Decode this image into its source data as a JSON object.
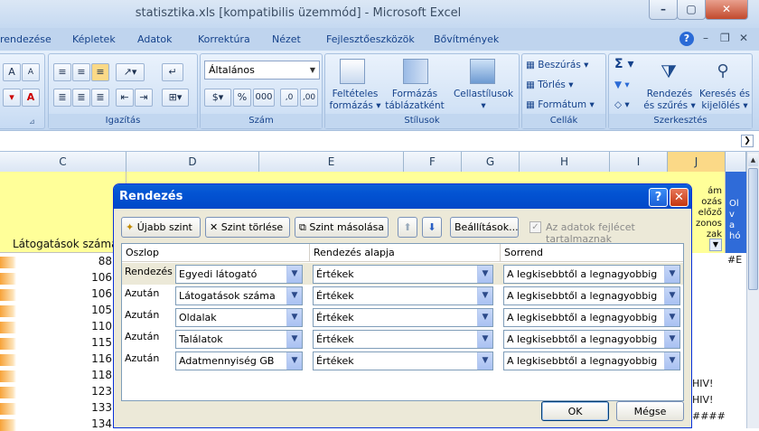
{
  "window": {
    "title": "statisztika.xls  [kompatibilis üzemmód] - Microsoft Excel"
  },
  "tabs": [
    "rendezése",
    "Képletek",
    "Adatok",
    "Korrektúra",
    "Nézet",
    "Fejlesztőeszközök",
    "Bővítmények"
  ],
  "ribbon": {
    "font_size_grow": "A",
    "font_size_shrink": "A",
    "number_format": "Általános",
    "groups": {
      "alignment": "Igazítás",
      "number": "Szám",
      "styles": "Stílusok",
      "cells": "Cellák",
      "editing": "Szerkesztés"
    },
    "styles": {
      "conditional": "Feltételes formázás",
      "format_table": "Formázás táblázatként",
      "cell_styles": "Cellastílusok"
    },
    "cells": {
      "insert": "Beszúrás",
      "delete": "Törlés",
      "format": "Formátum"
    },
    "editing": {
      "sort_filter": "Rendezés és szűrés",
      "find_select": "Keresés és kijelölés"
    },
    "number_buttons": {
      "percent": "%",
      "thousands": "000"
    }
  },
  "columns": [
    "C",
    "D",
    "E",
    "F",
    "G",
    "H",
    "I",
    "J"
  ],
  "sheet": {
    "header_c": "Látogatások száma",
    "values": [
      "88",
      "106",
      "106",
      "105",
      "110",
      "115",
      "116",
      "118",
      "123",
      "133",
      "134"
    ],
    "col_j_fragments": [
      "ám",
      "ozás",
      "előző",
      "zonos",
      "zak",
      "#E",
      "HIV!",
      "HIV!",
      "####"
    ],
    "col_k_fragments": [
      "Ol",
      "v",
      "a",
      "hó"
    ]
  },
  "dialog": {
    "title": "Rendezés",
    "help": "?",
    "close": "✕",
    "add_level": "Újabb szint",
    "delete_level": "Szint törlése",
    "copy_level": "Szint másolása",
    "options": "Beállítások...",
    "header_checkbox": "Az adatok fejlécet tartalmaznak",
    "col_headers": {
      "column": "Oszlop",
      "sort_on": "Rendezés alapja",
      "order": "Sorrend"
    },
    "rows": [
      {
        "label": "Rendezés",
        "column": "Egyedi látogató",
        "sort_on": "Értékek",
        "order": "A legkisebbtől a legnagyobbig"
      },
      {
        "label": "Azután",
        "column": "Látogatások száma",
        "sort_on": "Értékek",
        "order": "A legkisebbtől a legnagyobbig"
      },
      {
        "label": "Azután",
        "column": "Oldalak",
        "sort_on": "Értékek",
        "order": "A legkisebbtől a legnagyobbig"
      },
      {
        "label": "Azután",
        "column": "Találatok",
        "sort_on": "Értékek",
        "order": "A legkisebbtől a legnagyobbig"
      },
      {
        "label": "Azután",
        "column": "Adatmennyiség GB",
        "sort_on": "Értékek",
        "order": "A legkisebbtől a legnagyobbig"
      }
    ],
    "ok": "OK",
    "cancel": "Mégse"
  }
}
